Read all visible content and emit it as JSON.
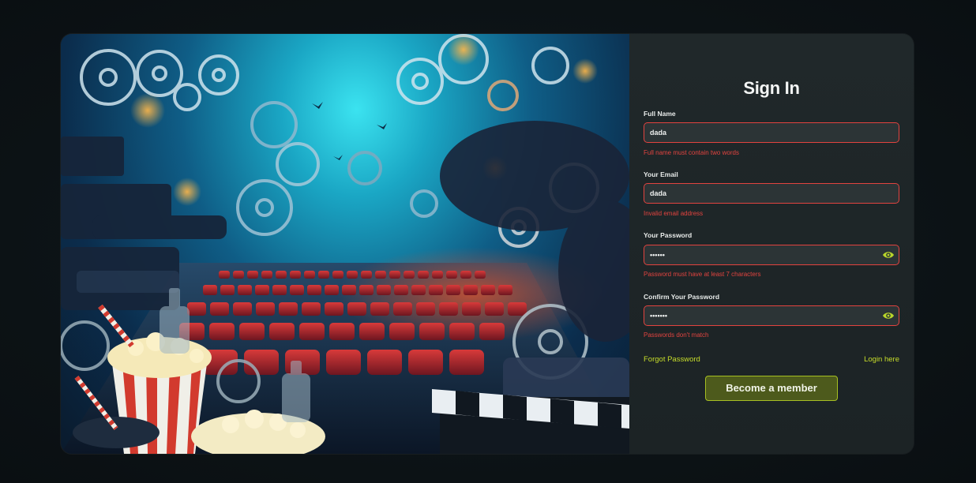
{
  "form": {
    "title": "Sign In",
    "full_name": {
      "label": "Full Name",
      "value": "dada",
      "error": "Full name must contain two words"
    },
    "email": {
      "label": "Your Email",
      "value": "dada",
      "error": "Invalid email address"
    },
    "password": {
      "label": "Your Password",
      "value": "••••••",
      "error": "Password must have at least 7 characters"
    },
    "confirm_password": {
      "label": "Confirm Your Password",
      "value": "•••••••",
      "error": "Passwords don't match"
    },
    "forgot_password": "Forgot Password",
    "login_here": "Login here",
    "submit": "Become a member"
  },
  "colors": {
    "accent": "#c7dd2a",
    "error": "#e2433f",
    "button_bg": "#4d5a1c",
    "panel_bg": "#1d2426",
    "page_bg": "#0c1215"
  },
  "icons": {
    "password_toggle": "eye-icon"
  }
}
